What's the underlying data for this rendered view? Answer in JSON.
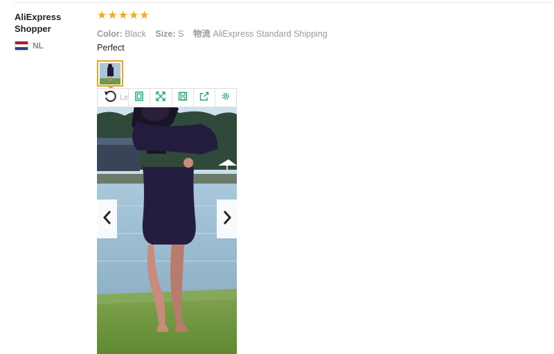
{
  "reviewer": {
    "name": "AliExpress Shopper",
    "country": "NL",
    "flag_colors": [
      "#ae1c28",
      "#ffffff",
      "#21468b"
    ]
  },
  "rating": {
    "stars": 5,
    "max": 5,
    "color": "#f5a623"
  },
  "attributes": {
    "color_label": "Color:",
    "color_value": "Black",
    "size_label": "Size:",
    "size_value": "S",
    "shipping_label": "物流",
    "shipping_value": "AliExpress Standard Shipping"
  },
  "review_text": "Perfect",
  "image_viewer": {
    "hint_text": "Le",
    "icons": [
      "rotate-icon",
      "fit-icon",
      "fullscreen-icon",
      "save-icon",
      "share-icon",
      "settings-icon"
    ],
    "accent_color": "#1aa86b"
  },
  "thumbnail": {
    "selected_border_color": "#f0a020"
  }
}
